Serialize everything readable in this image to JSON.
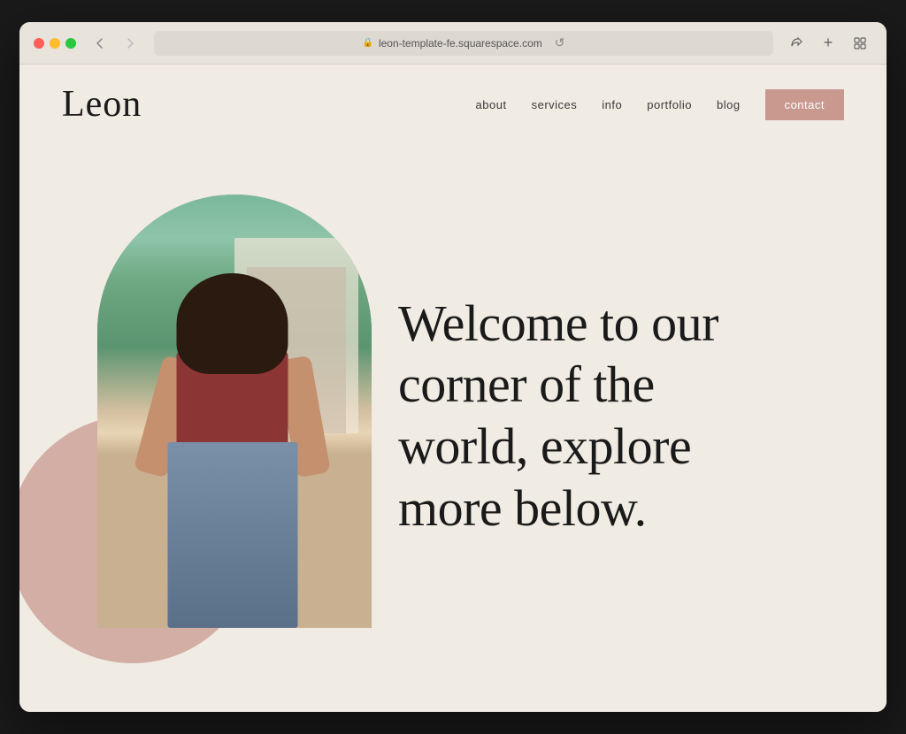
{
  "browser": {
    "url": "leon-template-fe.squarespace.com",
    "reload_label": "↺"
  },
  "header": {
    "logo": "Leon",
    "nav": {
      "items": [
        {
          "label": "about",
          "id": "about"
        },
        {
          "label": "services",
          "id": "services"
        },
        {
          "label": "info",
          "id": "info"
        },
        {
          "label": "portfolio",
          "id": "portfolio"
        },
        {
          "label": "blog",
          "id": "blog"
        }
      ],
      "contact_label": "contact"
    }
  },
  "hero": {
    "headline_line1": "Welcome to our",
    "headline_line2": "corner of the",
    "headline_line3": "world, explore",
    "headline_line4": "more below."
  },
  "colors": {
    "bg": "#f0ebe3",
    "accent_pink": "#c9998f",
    "text_dark": "#1a1a1a",
    "nav_text": "#3a3a3a"
  }
}
